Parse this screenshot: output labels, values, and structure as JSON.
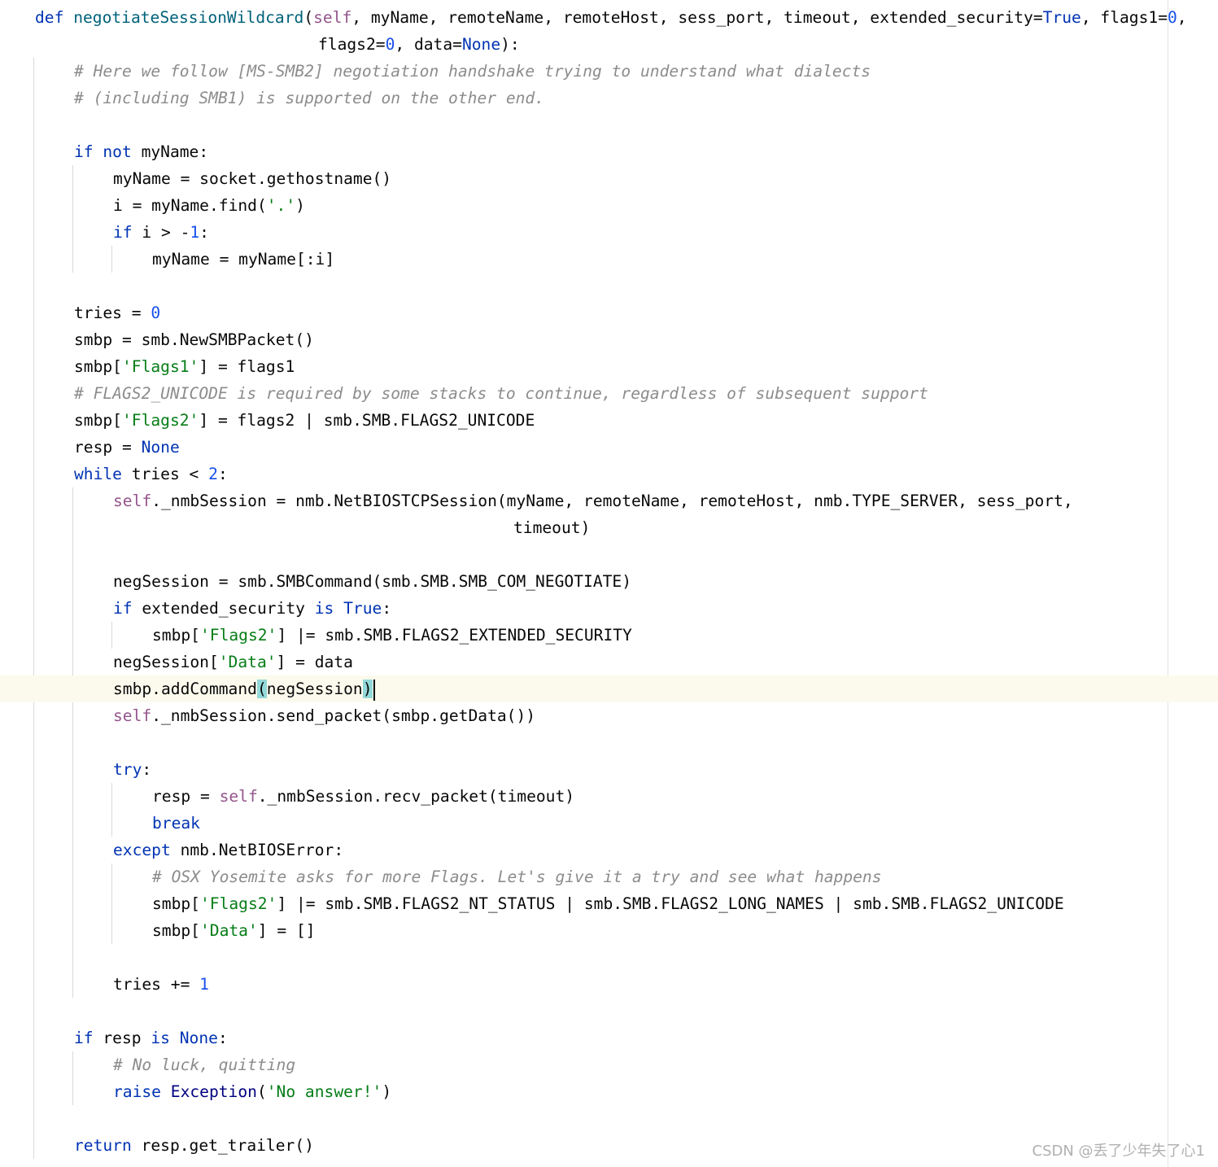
{
  "editor": {
    "lines": [
      {
        "indent": 0,
        "tokens": [
          [
            "kw",
            "def "
          ],
          [
            "fn",
            "negotiateSessionWildcard"
          ],
          [
            "",
            "("
          ],
          [
            "self",
            "self"
          ],
          [
            "",
            ", myName, remoteName, remoteHost, sess_port, timeout, extended_security="
          ],
          [
            "kw",
            "True"
          ],
          [
            "",
            ", flags1="
          ],
          [
            "num",
            "0"
          ],
          [
            "",
            ","
          ]
        ]
      },
      {
        "indent": 0,
        "offset": 391,
        "tokens": [
          [
            "",
            "flags2="
          ],
          [
            "num",
            "0"
          ],
          [
            "",
            ", data="
          ],
          [
            "kw",
            "None"
          ],
          [
            "",
            "):"
          ]
        ]
      },
      {
        "indent": 1,
        "tokens": [
          [
            "com",
            "# Here we follow [MS-SMB2] negotiation handshake trying to understand what dialects"
          ]
        ]
      },
      {
        "indent": 1,
        "tokens": [
          [
            "com",
            "# (including SMB1) is supported on the other end."
          ]
        ]
      },
      {
        "indent": 0,
        "tokens": []
      },
      {
        "indent": 1,
        "tokens": [
          [
            "kw",
            "if not "
          ],
          [
            "",
            "myName:"
          ]
        ]
      },
      {
        "indent": 2,
        "tokens": [
          [
            "",
            "myName = socket.gethostname()"
          ]
        ]
      },
      {
        "indent": 2,
        "tokens": [
          [
            "",
            "i = myName.find("
          ],
          [
            "str",
            "'.'"
          ],
          [
            "",
            ")"
          ]
        ]
      },
      {
        "indent": 2,
        "tokens": [
          [
            "kw",
            "if "
          ],
          [
            "",
            "i > -"
          ],
          [
            "num",
            "1"
          ],
          [
            "",
            ":"
          ]
        ]
      },
      {
        "indent": 3,
        "tokens": [
          [
            "",
            "myName = myName[:i]"
          ]
        ]
      },
      {
        "indent": 0,
        "tokens": []
      },
      {
        "indent": 1,
        "tokens": [
          [
            "",
            "tries = "
          ],
          [
            "num",
            "0"
          ]
        ]
      },
      {
        "indent": 1,
        "tokens": [
          [
            "",
            "smbp = smb.NewSMBPacket()"
          ]
        ]
      },
      {
        "indent": 1,
        "tokens": [
          [
            "",
            "smbp["
          ],
          [
            "str",
            "'Flags1'"
          ],
          [
            "",
            "] = flags1"
          ]
        ]
      },
      {
        "indent": 1,
        "tokens": [
          [
            "com",
            "# FLAGS2_UNICODE is required by some stacks to continue, regardless of subsequent support"
          ]
        ]
      },
      {
        "indent": 1,
        "tokens": [
          [
            "",
            "smbp["
          ],
          [
            "str",
            "'Flags2'"
          ],
          [
            "",
            "] = flags2 | smb.SMB.FLAGS2_UNICODE"
          ]
        ]
      },
      {
        "indent": 1,
        "tokens": [
          [
            "",
            "resp = "
          ],
          [
            "kw",
            "None"
          ]
        ]
      },
      {
        "indent": 1,
        "tokens": [
          [
            "kw",
            "while "
          ],
          [
            "",
            "tries < "
          ],
          [
            "num",
            "2"
          ],
          [
            "",
            ":"
          ]
        ]
      },
      {
        "indent": 2,
        "tokens": [
          [
            "self",
            "self"
          ],
          [
            "",
            "._nmbSession = nmb.NetBIOSTCPSession(myName, remoteName, remoteHost, nmb.TYPE_SERVER, sess_port,"
          ]
        ]
      },
      {
        "indent": 0,
        "offset": 631,
        "tokens": [
          [
            "",
            "timeout)"
          ]
        ]
      },
      {
        "indent": 0,
        "tokens": []
      },
      {
        "indent": 2,
        "tokens": [
          [
            "",
            "negSession = smb.SMBCommand(smb.SMB.SMB_COM_NEGOTIATE)"
          ]
        ]
      },
      {
        "indent": 2,
        "tokens": [
          [
            "kw",
            "if "
          ],
          [
            "",
            "extended_security "
          ],
          [
            "kw",
            "is True"
          ],
          [
            "",
            ":"
          ]
        ]
      },
      {
        "indent": 3,
        "tokens": [
          [
            "",
            "smbp["
          ],
          [
            "str",
            "'Flags2'"
          ],
          [
            "",
            "] |= smb.SMB.FLAGS2_EXTENDED_SECURITY"
          ]
        ]
      },
      {
        "indent": 2,
        "tokens": [
          [
            "",
            "negSession["
          ],
          [
            "str",
            "'Data'"
          ],
          [
            "",
            "] = data"
          ]
        ]
      },
      {
        "indent": 2,
        "current": true,
        "tokens": [
          [
            "",
            "smbp.addCommand"
          ],
          [
            "brace",
            "("
          ],
          [
            "",
            "negSession"
          ],
          [
            "brace",
            ")"
          ],
          [
            "caret",
            ""
          ]
        ]
      },
      {
        "indent": 2,
        "tokens": [
          [
            "self",
            "self"
          ],
          [
            "",
            "._nmbSession.send_packet(smbp.getData())"
          ]
        ]
      },
      {
        "indent": 0,
        "tokens": []
      },
      {
        "indent": 2,
        "tokens": [
          [
            "kw",
            "try"
          ],
          [
            "",
            ":"
          ]
        ]
      },
      {
        "indent": 3,
        "tokens": [
          [
            "",
            "resp = "
          ],
          [
            "self",
            "self"
          ],
          [
            "",
            "._nmbSession.recv_packet(timeout)"
          ]
        ]
      },
      {
        "indent": 3,
        "tokens": [
          [
            "kw",
            "break"
          ]
        ]
      },
      {
        "indent": 2,
        "tokens": [
          [
            "kw",
            "except "
          ],
          [
            "",
            "nmb.NetBIOSError:"
          ]
        ]
      },
      {
        "indent": 3,
        "tokens": [
          [
            "com",
            "# OSX Yosemite asks for more Flags. Let's give it a try and see what happens"
          ]
        ]
      },
      {
        "indent": 3,
        "tokens": [
          [
            "",
            "smbp["
          ],
          [
            "str",
            "'Flags2'"
          ],
          [
            "",
            "] |= smb.SMB.FLAGS2_NT_STATUS | smb.SMB.FLAGS2_LONG_NAMES | smb.SMB.FLAGS2_UNICODE"
          ]
        ]
      },
      {
        "indent": 3,
        "tokens": [
          [
            "",
            "smbp["
          ],
          [
            "str",
            "'Data'"
          ],
          [
            "",
            "] = []"
          ]
        ]
      },
      {
        "indent": 0,
        "tokens": []
      },
      {
        "indent": 2,
        "tokens": [
          [
            "",
            "tries += "
          ],
          [
            "num",
            "1"
          ]
        ]
      },
      {
        "indent": 0,
        "tokens": []
      },
      {
        "indent": 1,
        "tokens": [
          [
            "kw",
            "if "
          ],
          [
            "",
            "resp "
          ],
          [
            "kw",
            "is None"
          ],
          [
            "",
            ":"
          ]
        ]
      },
      {
        "indent": 2,
        "tokens": [
          [
            "com",
            "# No luck, quitting"
          ]
        ]
      },
      {
        "indent": 2,
        "tokens": [
          [
            "kw",
            "raise "
          ],
          [
            "builtin",
            "Exception"
          ],
          [
            "",
            "("
          ],
          [
            "str",
            "'No answer!'"
          ],
          [
            "",
            ")"
          ]
        ]
      },
      {
        "indent": 0,
        "tokens": []
      },
      {
        "indent": 1,
        "tokens": [
          [
            "kw",
            "return "
          ],
          [
            "",
            "resp.get_trailer()"
          ]
        ]
      }
    ]
  },
  "watermark": "CSDN @丢了少年失了心1",
  "colors": {
    "keyword": "#0033b3",
    "function": "#00627a",
    "self": "#94558d",
    "number": "#1750eb",
    "string": "#067d17",
    "comment": "#8c8c8c",
    "current_line": "#fcfaed",
    "brace_match": "#93d9d9"
  }
}
